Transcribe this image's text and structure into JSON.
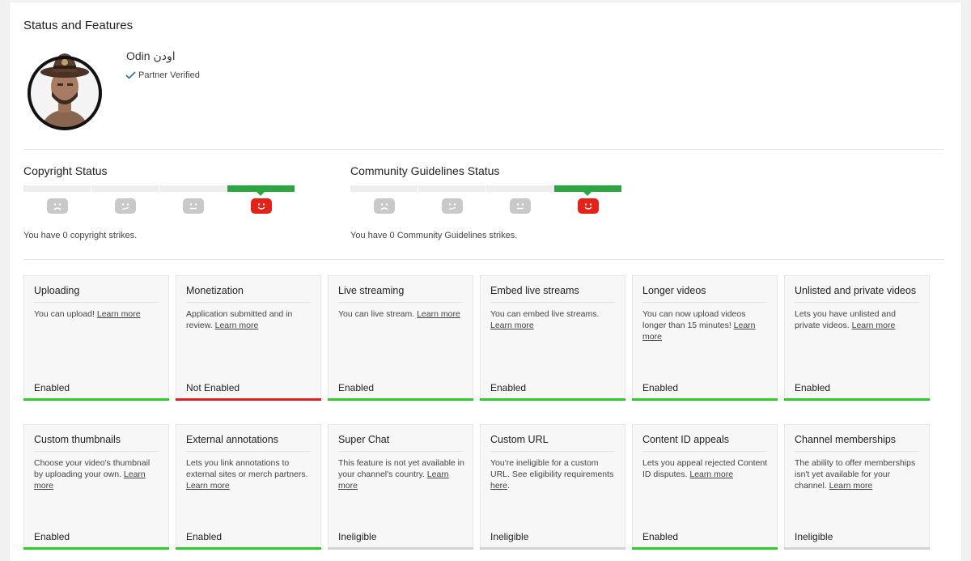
{
  "page": {
    "title": "Status and Features"
  },
  "channel": {
    "name": "Odin اودن",
    "verified_label": "Partner Verified"
  },
  "copyright": {
    "title": "Copyright Status",
    "strikes": 0,
    "message": "You have 0 copyright strikes."
  },
  "community": {
    "title": "Community Guidelines Status",
    "strikes": 0,
    "message": "You have 0 Community Guidelines strikes."
  },
  "colors": {
    "enabled": "#2bcc2b",
    "not_enabled": "#e02222",
    "ineligible": "#d3d3d3",
    "good_face": "#e62117",
    "strike_active": "#2ba640"
  },
  "features": [
    {
      "title": "Uploading",
      "desc": "You can upload! ",
      "link": "Learn more",
      "desc_after": "",
      "status": "Enabled",
      "state": "enabled"
    },
    {
      "title": "Monetization",
      "desc": "Application submitted and in review. ",
      "link": "Learn more",
      "desc_after": "",
      "status": "Not Enabled",
      "state": "not_enabled"
    },
    {
      "title": "Live streaming",
      "desc": "You can live stream. ",
      "link": "Learn more",
      "desc_after": "",
      "status": "Enabled",
      "state": "enabled"
    },
    {
      "title": "Embed live streams",
      "desc": "You can embed live streams. ",
      "link": "Learn more",
      "desc_after": "",
      "status": "Enabled",
      "state": "enabled"
    },
    {
      "title": "Longer videos",
      "desc": "You can now upload videos longer than 15 minutes! ",
      "link": "Learn more",
      "desc_after": "",
      "status": "Enabled",
      "state": "enabled"
    },
    {
      "title": "Unlisted and private videos",
      "desc": "Lets you have unlisted and private videos. ",
      "link": "Learn more",
      "desc_after": "",
      "status": "Enabled",
      "state": "enabled"
    },
    {
      "title": "Custom thumbnails",
      "desc": "Choose your video's thumbnail by uploading your own. ",
      "link": "Learn more",
      "desc_after": "",
      "status": "Enabled",
      "state": "enabled"
    },
    {
      "title": "External annotations",
      "desc": "Lets you link annotations to external sites or merch partners. ",
      "link": "Learn more",
      "desc_after": "",
      "status": "Enabled",
      "state": "enabled"
    },
    {
      "title": "Super Chat",
      "desc": "This feature is not yet available in your channel's country. ",
      "link": "Learn more",
      "desc_after": "",
      "status": "Ineligible",
      "state": "ineligible"
    },
    {
      "title": "Custom URL",
      "desc": "You're ineligible for a custom URL. See eligibility requirements ",
      "link": "here",
      "desc_after": ".",
      "status": "Ineligible",
      "state": "ineligible"
    },
    {
      "title": "Content ID appeals",
      "desc": "Lets you appeal rejected Content ID disputes. ",
      "link": "Learn more",
      "desc_after": "",
      "status": "Enabled",
      "state": "enabled"
    },
    {
      "title": "Channel memberships",
      "desc": "The ability to offer memberships isn't yet available for your channel. ",
      "link": "Learn more",
      "desc_after": "",
      "status": "Ineligible",
      "state": "ineligible"
    }
  ]
}
